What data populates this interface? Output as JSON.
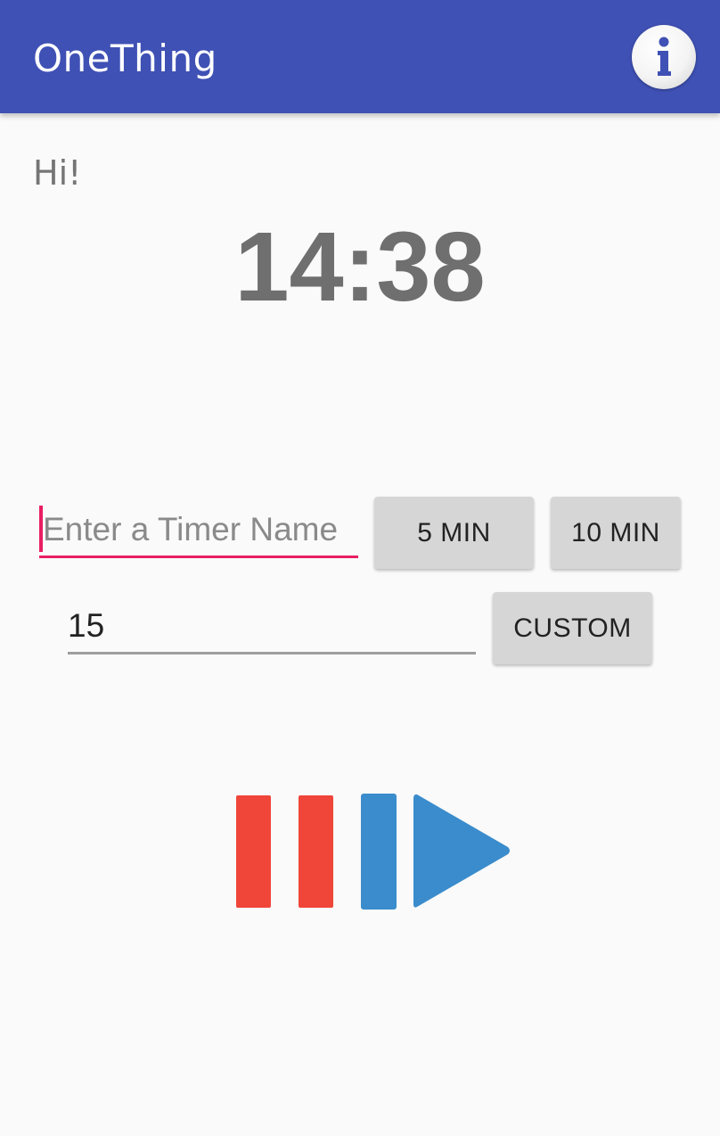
{
  "app_bar": {
    "title": "OneThing",
    "info_icon": "info-icon",
    "background_color": "#3f51b5"
  },
  "main": {
    "greeting": "Hi!",
    "clock": "14:38"
  },
  "timer_form": {
    "name_placeholder": "Enter a Timer Name",
    "name_value": "",
    "preset_5_label": "5 MIN",
    "preset_10_label": "10 MIN",
    "custom_minutes_value": "15",
    "custom_label": "CUSTOM",
    "accent_color": "#e91e63"
  },
  "playback": {
    "pause_icon": "pause-icon",
    "play_icon": "play-icon",
    "pause_color": "#f0463a",
    "play_color": "#3a8ccc"
  }
}
